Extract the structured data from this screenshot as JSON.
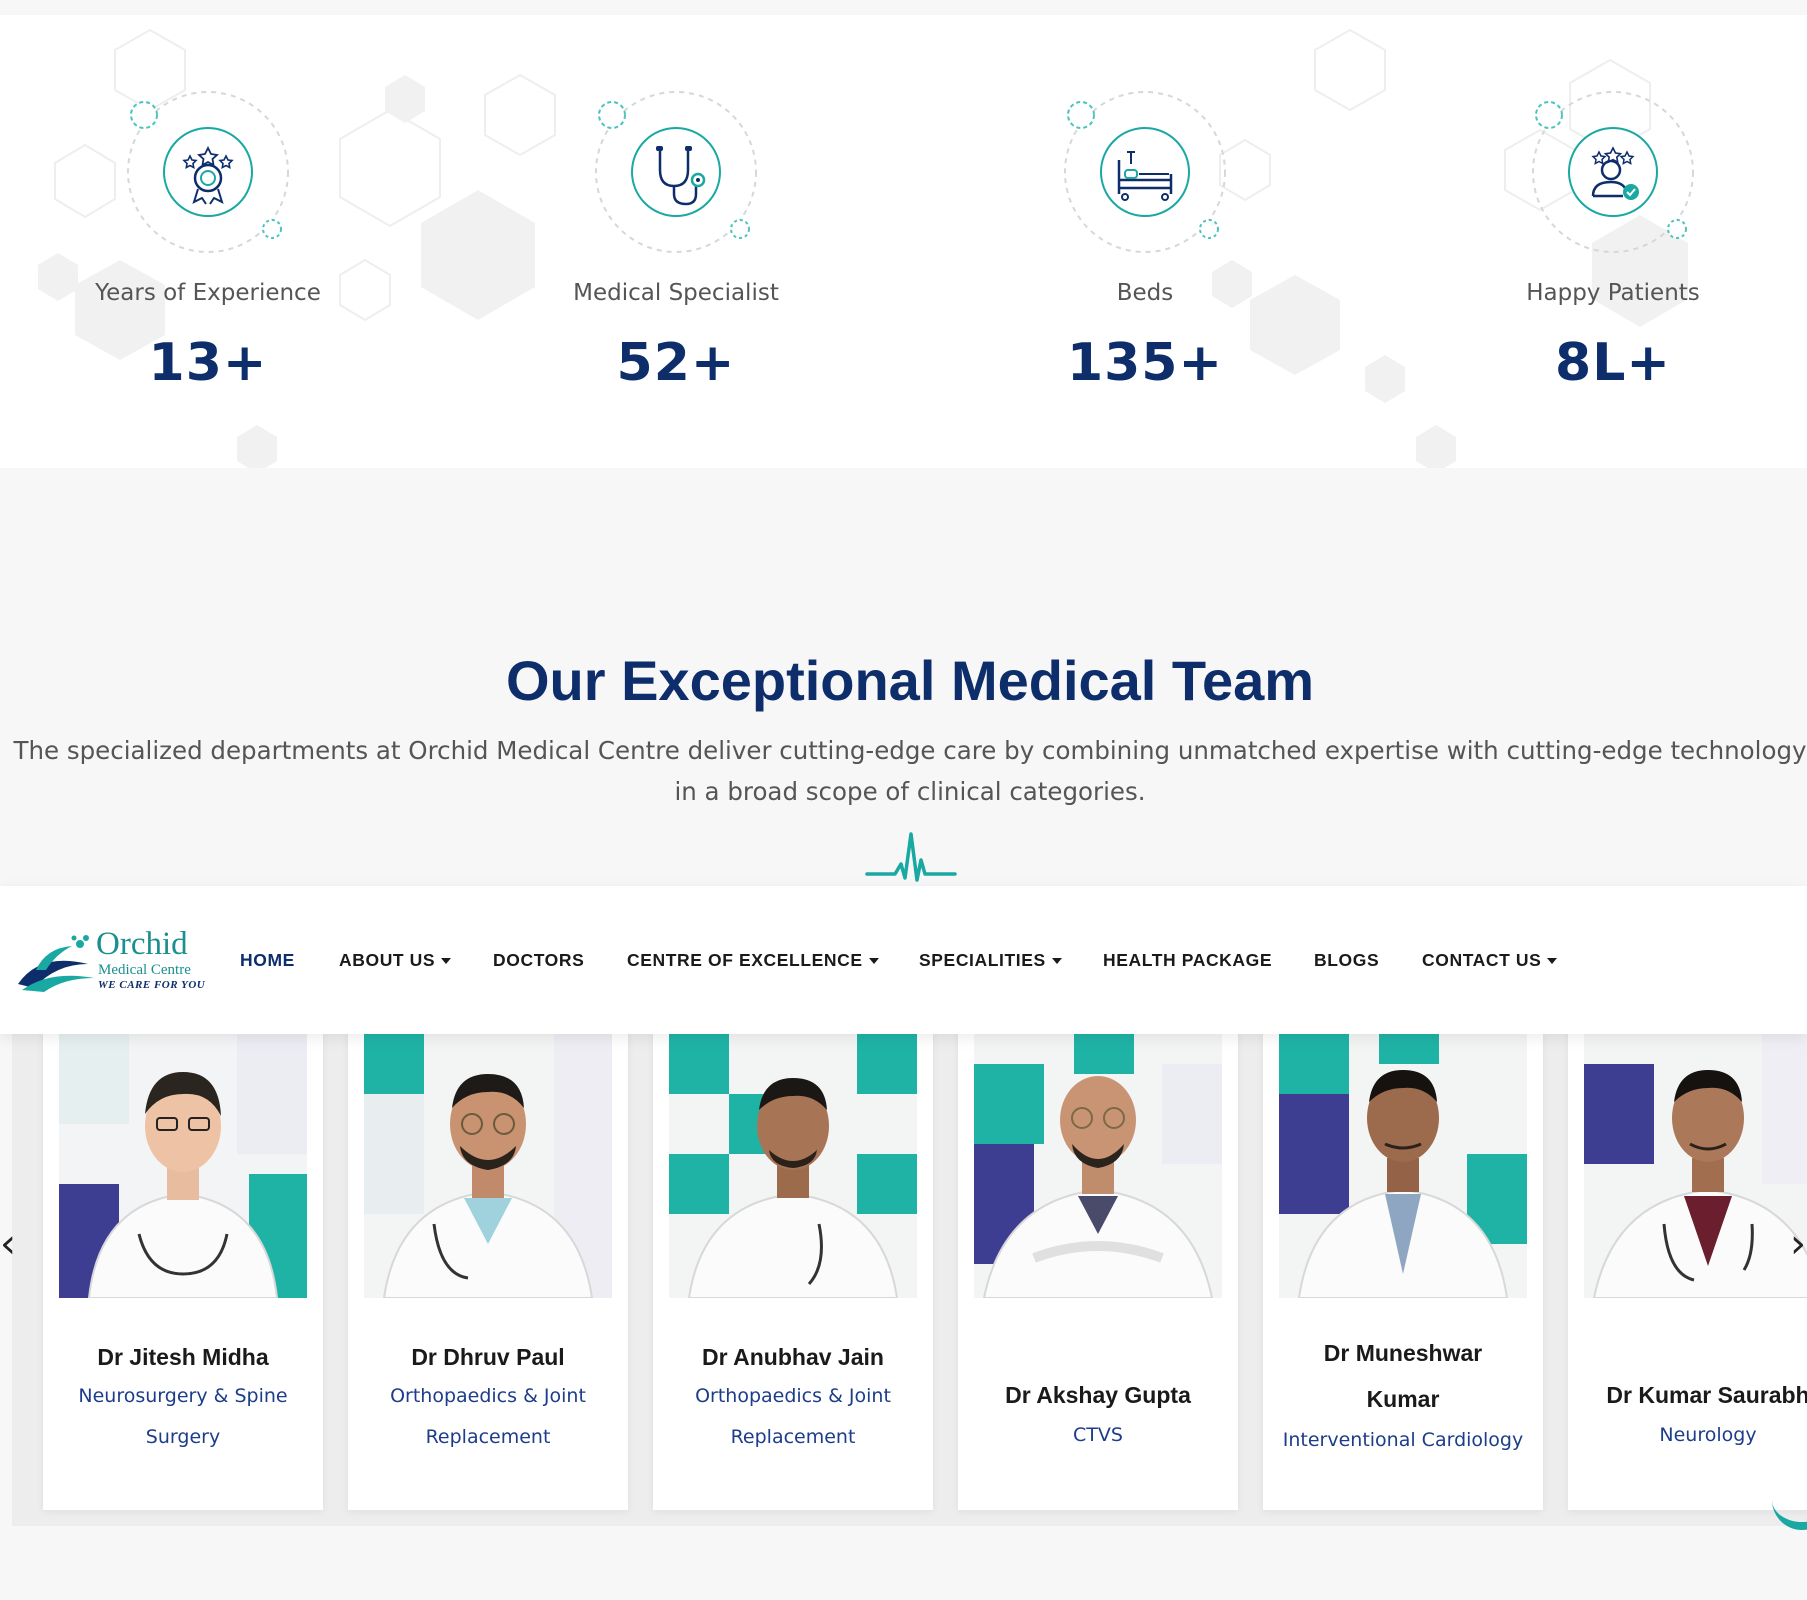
{
  "stats": [
    {
      "label": "Years of Experience",
      "value": "13+",
      "icon": "award-badge-icon"
    },
    {
      "label": "Medical Specialist",
      "value": "52+",
      "icon": "stethoscope-icon"
    },
    {
      "label": "Beds",
      "value": "135+",
      "icon": "hospital-bed-icon"
    },
    {
      "label": "Happy Patients",
      "value": "8L+",
      "icon": "happy-patient-icon"
    }
  ],
  "team": {
    "title": "Our Exceptional Medical Team",
    "description_line1": "The specialized departments at Orchid Medical Centre deliver cutting-edge care by combining unmatched expertise with cutting-edge technology",
    "description_line2": "in a broad scope of clinical categories."
  },
  "logo": {
    "name": "Orchid",
    "subtitle": "Medical Centre",
    "tagline": "WE CARE FOR YOU"
  },
  "nav": {
    "items": [
      {
        "label": "HOME",
        "active": true,
        "dropdown": false
      },
      {
        "label": "ABOUT US",
        "active": false,
        "dropdown": true
      },
      {
        "label": "DOCTORS",
        "active": false,
        "dropdown": false
      },
      {
        "label": "CENTRE OF EXCELLENCE",
        "active": false,
        "dropdown": true
      },
      {
        "label": "SPECIALITIES",
        "active": false,
        "dropdown": true
      },
      {
        "label": "HEALTH PACKAGE",
        "active": false,
        "dropdown": false
      },
      {
        "label": "BLOGS",
        "active": false,
        "dropdown": false
      },
      {
        "label": "CONTACT US",
        "active": false,
        "dropdown": true
      }
    ]
  },
  "doctors": [
    {
      "name": "Dr Jitesh Midha",
      "specialty_line1": "Neurosurgery & Spine",
      "specialty_line2": "Surgery"
    },
    {
      "name": "Dr Dhruv Paul",
      "specialty_line1": "Orthopaedics & Joint",
      "specialty_line2": "Replacement"
    },
    {
      "name": "Dr Anubhav Jain",
      "specialty_line1": "Orthopaedics & Joint",
      "specialty_line2": "Replacement"
    },
    {
      "name": "Dr Akshay Gupta",
      "specialty_line1": "CTVS",
      "specialty_line2": ""
    },
    {
      "name_line1": "Dr Muneshwar",
      "name_line2": "Kumar",
      "specialty_line1": "Interventional Cardiology"
    },
    {
      "name": "Dr Kumar Saurabh",
      "specialty_line1": "Neurology"
    }
  ],
  "slider": {
    "prev_label": "‹",
    "next_label": "›"
  },
  "colors": {
    "navy": "#0e2d6b",
    "teal": "#1aa8a2",
    "specialty_blue": "#1d3d8a"
  }
}
